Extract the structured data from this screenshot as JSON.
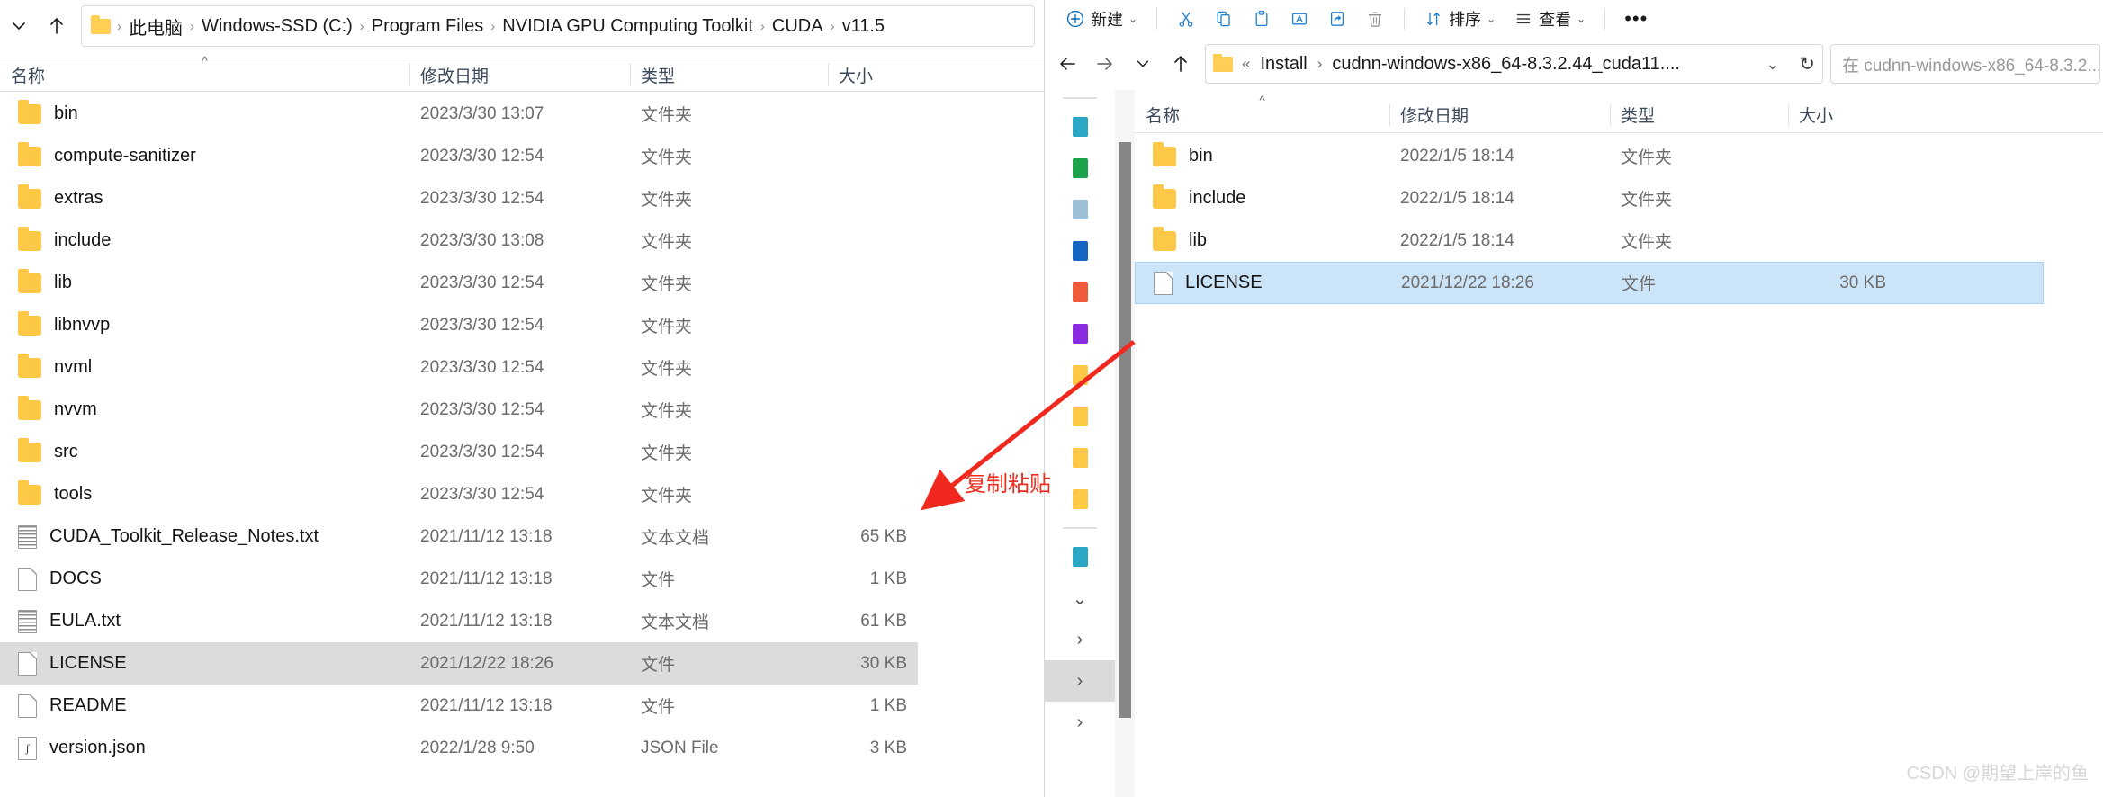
{
  "left_window": {
    "nav": {
      "recent_label": "⌄",
      "up_label": "↑"
    },
    "breadcrumb": {
      "folder_icon": "folder-icon",
      "items": [
        "此电脑",
        "Windows-SSD (C:)",
        "Program Files",
        "NVIDIA GPU Computing Toolkit",
        "CUDA",
        "v11.5"
      ],
      "separator": "›"
    },
    "columns": [
      {
        "label": "名称",
        "sorted": true,
        "sort_mark": "^"
      },
      {
        "label": "修改日期"
      },
      {
        "label": "类型"
      },
      {
        "label": "大小"
      }
    ],
    "rows": [
      {
        "icon": "folder-icon",
        "name": "bin",
        "date": "2023/3/30 13:07",
        "type": "文件夹",
        "size": "",
        "selected": false
      },
      {
        "icon": "folder-icon",
        "name": "compute-sanitizer",
        "date": "2023/3/30 12:54",
        "type": "文件夹",
        "size": "",
        "selected": false
      },
      {
        "icon": "folder-icon",
        "name": "extras",
        "date": "2023/3/30 12:54",
        "type": "文件夹",
        "size": "",
        "selected": false
      },
      {
        "icon": "folder-icon",
        "name": "include",
        "date": "2023/3/30 13:08",
        "type": "文件夹",
        "size": "",
        "selected": false
      },
      {
        "icon": "folder-icon",
        "name": "lib",
        "date": "2023/3/30 12:54",
        "type": "文件夹",
        "size": "",
        "selected": false
      },
      {
        "icon": "folder-icon",
        "name": "libnvvp",
        "date": "2023/3/30 12:54",
        "type": "文件夹",
        "size": "",
        "selected": false
      },
      {
        "icon": "folder-icon",
        "name": "nvml",
        "date": "2023/3/30 12:54",
        "type": "文件夹",
        "size": "",
        "selected": false
      },
      {
        "icon": "folder-icon",
        "name": "nvvm",
        "date": "2023/3/30 12:54",
        "type": "文件夹",
        "size": "",
        "selected": false
      },
      {
        "icon": "folder-icon",
        "name": "src",
        "date": "2023/3/30 12:54",
        "type": "文件夹",
        "size": "",
        "selected": false
      },
      {
        "icon": "folder-icon",
        "name": "tools",
        "date": "2023/3/30 12:54",
        "type": "文件夹",
        "size": "",
        "selected": false
      },
      {
        "icon": "text-file-icon",
        "name": "CUDA_Toolkit_Release_Notes.txt",
        "date": "2021/11/12 13:18",
        "type": "文本文档",
        "size": "65 KB",
        "selected": false
      },
      {
        "icon": "file-icon",
        "name": "DOCS",
        "date": "2021/11/12 13:18",
        "type": "文件",
        "size": "1 KB",
        "selected": false
      },
      {
        "icon": "text-file-icon",
        "name": "EULA.txt",
        "date": "2021/11/12 13:18",
        "type": "文本文档",
        "size": "61 KB",
        "selected": false
      },
      {
        "icon": "file-icon",
        "name": "LICENSE",
        "date": "2021/12/22 18:26",
        "type": "文件",
        "size": "30 KB",
        "selected": true
      },
      {
        "icon": "file-icon",
        "name": "README",
        "date": "2021/11/12 13:18",
        "type": "文件",
        "size": "1 KB",
        "selected": false
      },
      {
        "icon": "json-file-icon",
        "name": "version.json",
        "date": "2022/1/28 9:50",
        "type": "JSON File",
        "size": "3 KB",
        "selected": false
      }
    ]
  },
  "right_window": {
    "toolbar": {
      "new_label": "新建",
      "cut_label": "cut-icon",
      "copy_label": "copy-icon",
      "paste_label": "paste-icon",
      "rename_label": "rename-icon",
      "share_label": "share-icon",
      "delete_label": "delete-icon",
      "sort_label": "排序",
      "view_label": "查看",
      "more_label": "•••",
      "chevron": "⌄"
    },
    "nav": {
      "back": "←",
      "forward": "→",
      "recent": "⌄",
      "up": "↑"
    },
    "address": {
      "folder_icon": "folder-icon",
      "prefix": "«",
      "items": [
        "Install",
        "cudnn-windows-x86_64-8.3.2.44_cuda11...."
      ],
      "separator": "›",
      "dropdown": "⌄",
      "refresh": "↻"
    },
    "search": {
      "placeholder": "在 cudnn-windows-x86_64-8.3.2..."
    },
    "columns": [
      {
        "label": "名称",
        "sorted": true,
        "sort_mark": "^"
      },
      {
        "label": "修改日期"
      },
      {
        "label": "类型"
      },
      {
        "label": "大小"
      }
    ],
    "rows": [
      {
        "icon": "folder-icon",
        "name": "bin",
        "date": "2022/1/5 18:14",
        "type": "文件夹",
        "size": "",
        "selected": false
      },
      {
        "icon": "folder-icon",
        "name": "include",
        "date": "2022/1/5 18:14",
        "type": "文件夹",
        "size": "",
        "selected": false
      },
      {
        "icon": "folder-icon",
        "name": "lib",
        "date": "2022/1/5 18:14",
        "type": "文件夹",
        "size": "",
        "selected": false
      },
      {
        "icon": "file-icon",
        "name": "LICENSE",
        "date": "2021/12/22 18:26",
        "type": "文件",
        "size": "30 KB",
        "selected": true
      }
    ],
    "sidebar": {
      "items": [
        {
          "name": "quick-access-item",
          "color": "#2aa7c4"
        },
        {
          "name": "onedrive-item",
          "color": "#1aa34a"
        },
        {
          "name": "document-item",
          "color": "#9bbfd4"
        },
        {
          "name": "blue-folder-item",
          "color": "#1466c0"
        },
        {
          "name": "orange-item",
          "color": "#ef5a3a"
        },
        {
          "name": "purple-item",
          "color": "#8a2be2"
        },
        {
          "name": "folder-item-1",
          "color": "#fcc846"
        },
        {
          "name": "folder-item-2",
          "color": "#fcc846"
        },
        {
          "name": "folder-item-3",
          "color": "#fcc846"
        },
        {
          "name": "folder-item-4",
          "color": "#fcc846"
        }
      ],
      "this_pc": {
        "name": "this-pc-item",
        "color": "#2aa7c4"
      },
      "expanders": [
        "⌄",
        "›",
        "›",
        "›"
      ]
    }
  },
  "annotation": {
    "text": "复制粘贴",
    "color": "#ee2b1f"
  },
  "watermark": {
    "text": "CSDN @期望上岸的鱼"
  }
}
